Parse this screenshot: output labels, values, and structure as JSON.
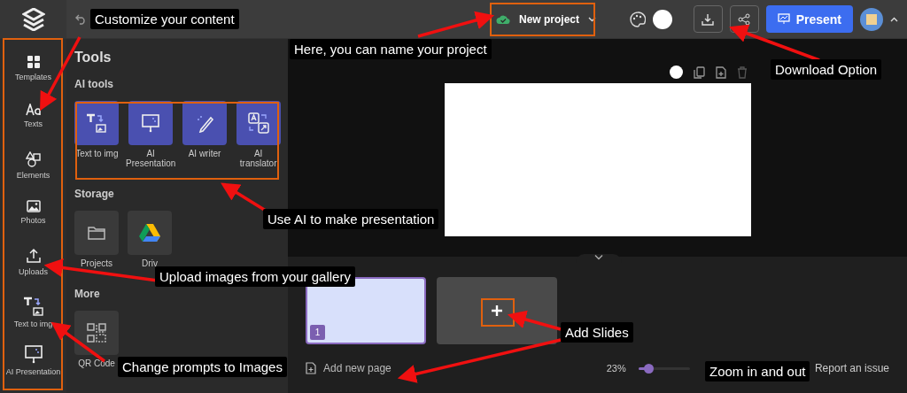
{
  "topbar": {
    "project_name": "New project",
    "present_label": "Present"
  },
  "rail": [
    {
      "kind": "templates",
      "label": "Templates"
    },
    {
      "kind": "texts",
      "label": "Texts"
    },
    {
      "kind": "elements",
      "label": "Elements"
    },
    {
      "kind": "photos",
      "label": "Photos"
    },
    {
      "kind": "uploads",
      "label": "Uploads"
    },
    {
      "kind": "text2img",
      "label": "Text to img"
    },
    {
      "kind": "presentation",
      "label": "AI Presentation"
    }
  ],
  "tools": {
    "title": "Tools",
    "sections": [
      {
        "heading": "AI tools",
        "items": [
          {
            "kind": "text2img",
            "label": "Text to img"
          },
          {
            "kind": "presentation",
            "label": "AI Presentation"
          },
          {
            "kind": "writer",
            "label": "AI writer"
          },
          {
            "kind": "translator",
            "label": "AI translator"
          }
        ]
      },
      {
        "heading": "Storage",
        "items": [
          {
            "kind": "folder",
            "label": "Projects"
          },
          {
            "kind": "drive",
            "label": "Driv"
          }
        ]
      },
      {
        "heading": "More",
        "items": [
          {
            "kind": "qr",
            "label": "QR Code"
          }
        ]
      }
    ]
  },
  "slides": [
    {
      "number": "1",
      "selected": true
    }
  ],
  "add_page_label": "Add new page",
  "zoom": {
    "reading": "23%",
    "level": 0.2
  },
  "report_link": "Report an issue",
  "annotations": [
    {
      "text": "Customize your content"
    },
    {
      "text": "Here, you can name your project"
    },
    {
      "text": "Download Option"
    },
    {
      "text": "Use AI to make presentation"
    },
    {
      "text": "Upload images from your gallery"
    },
    {
      "text": "Change prompts to Images"
    },
    {
      "text": "Add Slides"
    },
    {
      "text": "Zoom in and out"
    }
  ]
}
